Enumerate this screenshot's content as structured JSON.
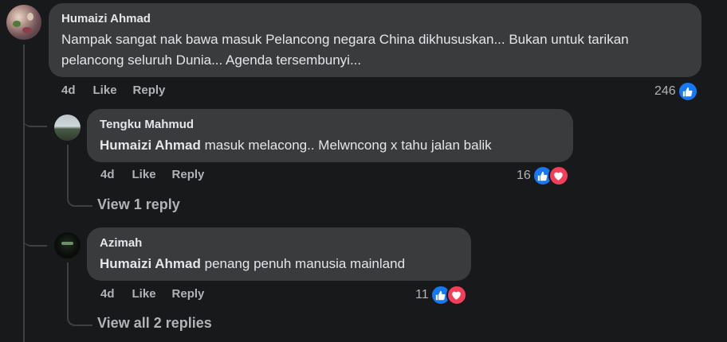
{
  "comments": [
    {
      "author": "Humaizi Ahmad",
      "text": "Nampak sangat nak bawa masuk Pelancong negara China dikhususkan... Bukan untuk tarikan pelancong seluruh Dunia... Agenda tersembunyi...",
      "time": "4d",
      "like_label": "Like",
      "reply_label": "Reply",
      "reaction_count": "246",
      "reactions": [
        "like-icon"
      ]
    },
    {
      "author": "Tengku Mahmud",
      "mention": "Humaizi Ahmad",
      "text": " masuk melacong.. Melwncong x tahu jalan balik",
      "time": "4d",
      "like_label": "Like",
      "reply_label": "Reply",
      "reaction_count": "16",
      "reactions": [
        "like-icon",
        "love-icon"
      ],
      "view_replies": "View 1 reply"
    },
    {
      "author": "Azimah",
      "mention": "Humaizi Ahmad",
      "text": " penang penuh manusia mainland",
      "time": "4d",
      "like_label": "Like",
      "reply_label": "Reply",
      "reaction_count": "11",
      "reactions": [
        "like-icon",
        "love-icon"
      ],
      "view_replies": "View all 2 replies"
    }
  ],
  "colors": {
    "background": "#18191a",
    "bubble": "#3a3b3c",
    "text": "#e4e6eb",
    "secondary_text": "#b0b3b8",
    "like_blue": "#1877f2",
    "love_red": "#f33e58"
  }
}
